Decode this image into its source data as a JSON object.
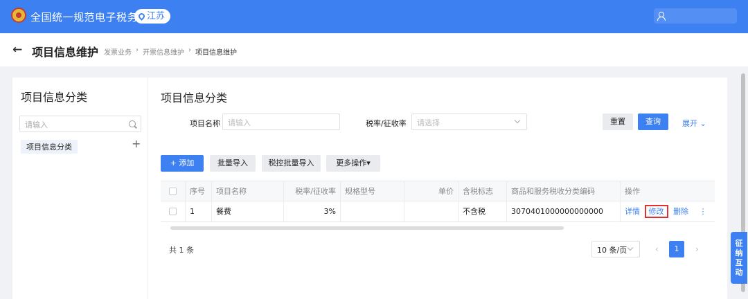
{
  "header": {
    "app_title": "全国统一规范电子税务局",
    "region": "江苏"
  },
  "breadcrumb_bar": {
    "back_label": "←",
    "page_title": "项目信息维护",
    "crumbs": [
      "发票业务",
      "›",
      "开票信息维护",
      "›",
      "项目信息维护"
    ]
  },
  "left_panel": {
    "title": "项目信息分类",
    "search_placeholder": "请输入",
    "tree_item": "项目信息分类",
    "add_symbol": "+"
  },
  "main": {
    "title": "项目信息分类",
    "filters": {
      "name_label": "项目名称",
      "name_placeholder": "请输入",
      "rate_label": "税率/征收率",
      "rate_placeholder": "请选择"
    },
    "buttons": {
      "reset": "重置",
      "query": "查询",
      "expand": "展开"
    },
    "toolbar": {
      "add": "+ 添加",
      "batch_import": "批量导入",
      "tax_batch_import": "税控批量导入",
      "more": "更多操作▾"
    },
    "table": {
      "headers": [
        "序号",
        "项目名称",
        "税率/征收率",
        "规格型号",
        "单价",
        "含税标志",
        "商品和服务税收分类编码",
        "操作"
      ],
      "rows": [
        {
          "index": "1",
          "name": "餐费",
          "rate": "3%",
          "spec": "",
          "price": "",
          "tax_flag": "不含税",
          "code": "3070401000000000000"
        }
      ],
      "row_actions": {
        "detail": "详情",
        "edit": "修改",
        "delete": "删除",
        "more": "⋮"
      }
    },
    "pagination": {
      "total": "共 1 条",
      "page_size": "10 条/页",
      "prev": "‹",
      "next": "›",
      "current_page": "1"
    }
  },
  "side_tab": [
    "征",
    "纳",
    "互",
    "动"
  ],
  "colors": {
    "primary": "#3d80f2",
    "highlight_border": "#e03030"
  }
}
